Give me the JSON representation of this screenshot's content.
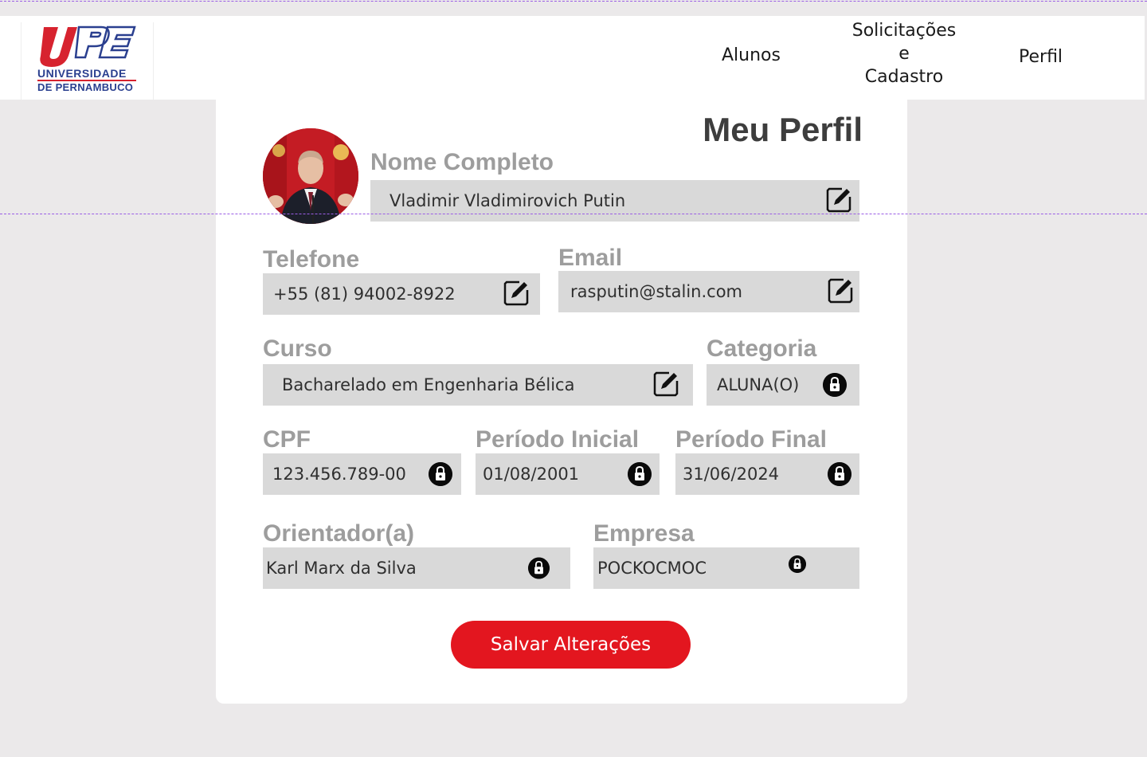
{
  "header": {
    "logo": {
      "mark": "UPE",
      "line1": "UNIVERSIDADE",
      "line2": "DE PERNAMBUCO"
    },
    "nav": {
      "alunos": "Alunos",
      "solicitacoes_line1": "Solicitações",
      "solicitacoes_line2": "e",
      "solicitacoes_line3": "Cadastro",
      "perfil": "Perfil"
    }
  },
  "profile": {
    "title": "Meu Perfil",
    "avatar_icon": "profile-photo",
    "fields": {
      "nome": {
        "label": "Nome Completo",
        "value": "Vladimir Vladimirovich Putin",
        "icon": "edit-icon"
      },
      "telefone": {
        "label": "Telefone",
        "value": "+55 (81) 94002-8922",
        "icon": "edit-icon"
      },
      "email": {
        "label": "Email",
        "value": "rasputin@stalin.com",
        "icon": "edit-icon"
      },
      "curso": {
        "label": "Curso",
        "value": "Bacharelado em Engenharia Bélica",
        "icon": "edit-icon"
      },
      "categoria": {
        "label": "Categoria",
        "value": "ALUNA(O)",
        "icon": "lock-icon"
      },
      "cpf": {
        "label": "CPF",
        "value": "123.456.789-00",
        "icon": "lock-icon"
      },
      "periodo_inicial": {
        "label": "Período Inicial",
        "value": "01/08/2001",
        "icon": "lock-icon"
      },
      "periodo_final": {
        "label": "Período Final",
        "value": "31/06/2024",
        "icon": "lock-icon"
      },
      "orientador": {
        "label": "Orientador(a)",
        "value": "Karl Marx da Silva",
        "icon": "lock-icon"
      },
      "empresa": {
        "label": "Empresa",
        "value": "POCKOCMOC",
        "icon": "lock-icon"
      }
    },
    "save_label": "Salvar Alterações"
  },
  "colors": {
    "background": "#ebe9ea",
    "field_bg": "#d9d9d9",
    "label_gray": "#9d9d9d",
    "primary_red": "#e3161f",
    "logo_red": "#d7232f",
    "logo_blue": "#2a3f8f"
  }
}
